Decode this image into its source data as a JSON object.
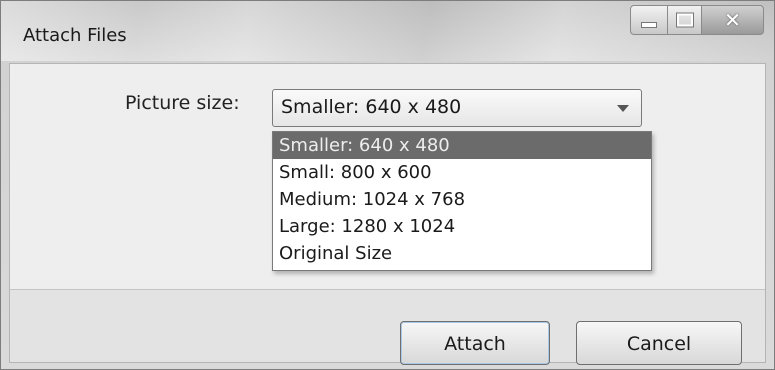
{
  "window": {
    "title": "Attach Files",
    "controls": [
      "minimize",
      "maximize",
      "close"
    ]
  },
  "form": {
    "picture_size_label": "Picture size:",
    "picture_size_value": "Smaller: 640 x 480"
  },
  "dropdown": {
    "options": [
      "Smaller: 640 x 480",
      "Small: 800 x 600",
      "Medium: 1024 x 768",
      "Large: 1280 x 1024",
      "Original Size"
    ],
    "selected_index": 0
  },
  "buttons": {
    "attach": "Attach",
    "cancel": "Cancel"
  },
  "colors": {
    "selected_option_bg": "#6b6b6b",
    "window_bg": "#eeeeee"
  }
}
